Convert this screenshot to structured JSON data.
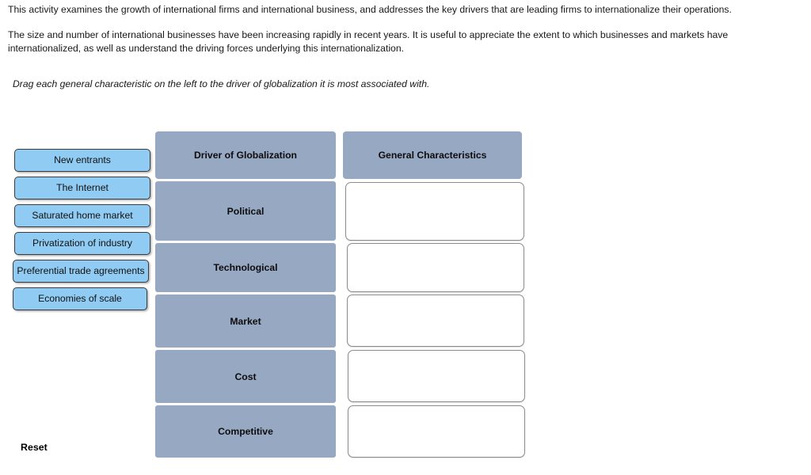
{
  "intro": {
    "paragraph_1": "This activity examines the growth of international firms and international business, and addresses the key drivers that are leading firms to internationalize their operations.",
    "paragraph_2": "The size and number of international businesses have been increasing rapidly in recent years. It is useful to appreciate the extent to which businesses and markets have internationalized, as well as understand the driving forces underlying this internationalization.",
    "instruction": "Drag each general characteristic on the left to the driver of globalization it is most associated with."
  },
  "tokens": [
    {
      "label": "New entrants"
    },
    {
      "label": "The Internet"
    },
    {
      "label": "Saturated home market"
    },
    {
      "label": "Privatization of industry"
    },
    {
      "label": "Preferential trade agreements"
    },
    {
      "label": "Economies of scale"
    }
  ],
  "grid": {
    "driver_column": {
      "header": "Driver of Globalization",
      "rows": [
        {
          "label": "Political"
        },
        {
          "label": "Technological"
        },
        {
          "label": "Market"
        },
        {
          "label": "Cost"
        },
        {
          "label": "Competitive"
        }
      ]
    },
    "target_column": {
      "header": "General Characteristics",
      "dropzones": [
        {
          "content": ""
        },
        {
          "content": ""
        },
        {
          "content": ""
        },
        {
          "content": ""
        },
        {
          "content": ""
        }
      ]
    }
  },
  "controls": {
    "reset_label": "Reset"
  },
  "colors": {
    "token_fill": "#8FCBF2",
    "header_fill": "#97A8C2",
    "dropzone_border": "#8C8C8C",
    "page_background": "#FFFFFF"
  }
}
